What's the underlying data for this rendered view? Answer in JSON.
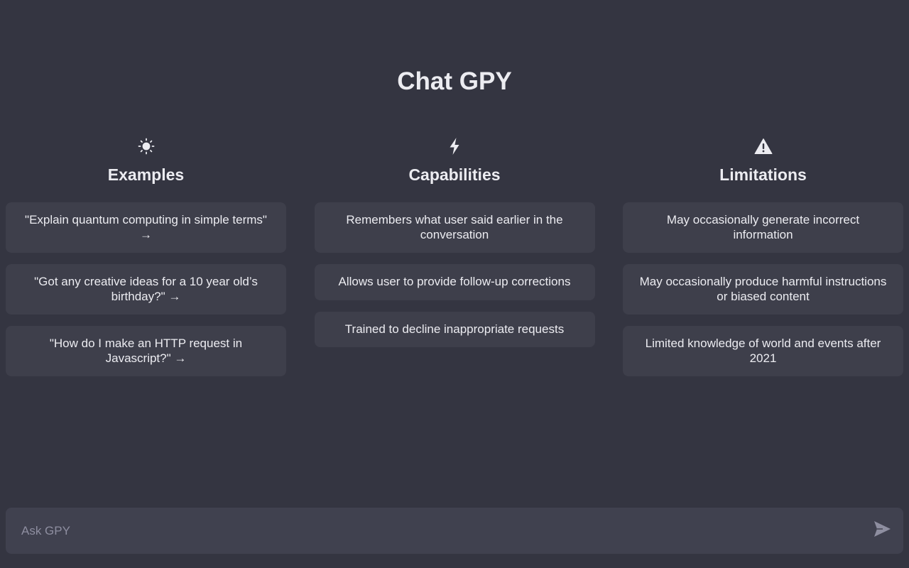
{
  "app": {
    "title": "Chat GPY"
  },
  "columns": [
    {
      "icon": "sun-icon",
      "heading": "Examples",
      "items": [
        "\"Explain quantum computing in simple terms\" →",
        "\"Got any creative ideas for a 10 year old’s birthday?\" →",
        "\"How do I make an HTTP request in Javascript?\" →"
      ]
    },
    {
      "icon": "lightning-icon",
      "heading": "Capabilities",
      "items": [
        "Remembers what user said earlier in the conversation",
        "Allows user to provide follow-up corrections",
        "Trained to decline inappropriate requests"
      ]
    },
    {
      "icon": "warning-icon",
      "heading": "Limitations",
      "items": [
        "May occasionally generate incorrect information",
        "May occasionally produce harmful instructions or biased content",
        "Limited knowledge of world and events after 2021"
      ]
    }
  ],
  "input": {
    "placeholder": "Ask GPY",
    "value": ""
  },
  "send_icon": "send-icon",
  "colors": {
    "background": "#343541",
    "card": "#3e3f4b",
    "input": "#40414f",
    "text": "#ececf1",
    "muted": "#8e8ea0"
  }
}
